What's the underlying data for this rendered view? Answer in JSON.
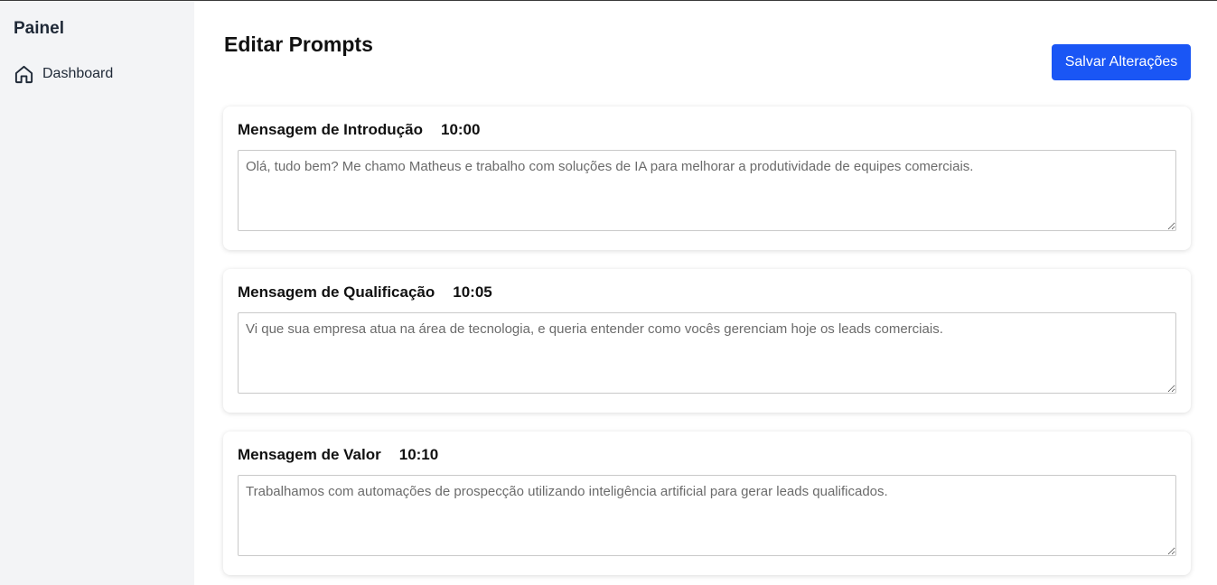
{
  "sidebar": {
    "title": "Painel",
    "items": [
      {
        "label": "Dashboard",
        "icon": "home-icon"
      }
    ]
  },
  "main": {
    "title": "Editar Prompts",
    "save_label": "Salvar Alterações",
    "cards": [
      {
        "title": "Mensagem de Introdução",
        "time": "10:00",
        "text": "Olá, tudo bem? Me chamo Matheus e trabalho com soluções de IA para melhorar a produtividade de equipes comerciais."
      },
      {
        "title": "Mensagem de Qualificação",
        "time": "10:05",
        "text": "Vi que sua empresa atua na área de tecnologia, e queria entender como vocês gerenciam hoje os leads comerciais."
      },
      {
        "title": "Mensagem de Valor",
        "time": "10:10",
        "text": "Trabalhamos com automações de prospecção utilizando inteligência artificial para gerar leads qualificados."
      }
    ]
  },
  "colors": {
    "accent": "#1a56f5",
    "sidebar_bg": "#f3f4f6"
  }
}
